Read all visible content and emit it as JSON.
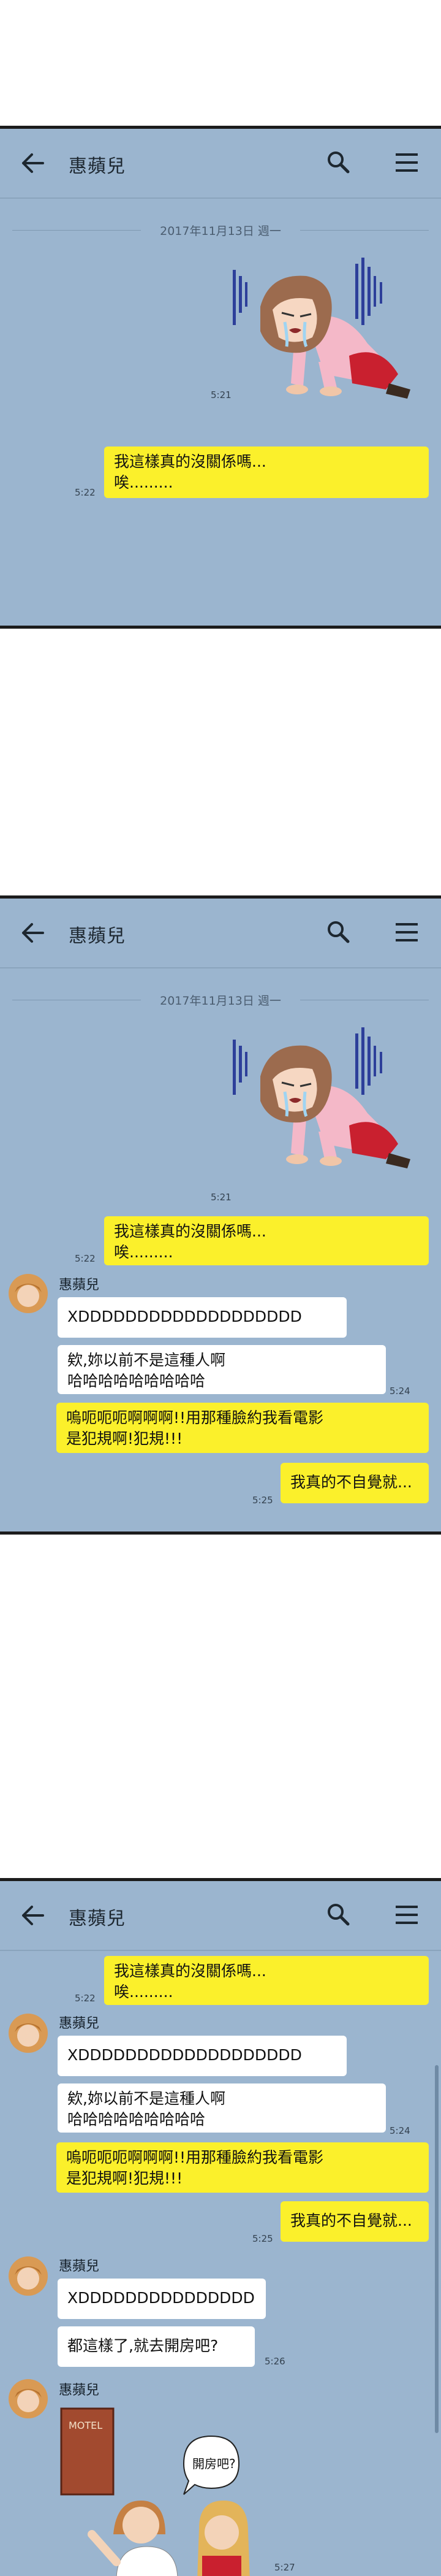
{
  "chat": {
    "title": "惠蘋兒"
  },
  "date_divider": "2017年11月13日 週一",
  "p1": {
    "sticker_time": "5:21",
    "msg1": {
      "text": "我這樣真的沒關係嗎...\n唉.........",
      "time": "5:22"
    }
  },
  "p2": {
    "sticker_time": "5:21",
    "msg1": {
      "text": "我這樣真的沒關係嗎...\n唉.........",
      "time": "5:22"
    },
    "sender": "惠蘋兒",
    "msg2": "XDDDDDDDDDDDDDDDDDDD",
    "msg3": "欸,妳以前不是這種人啊\n哈哈哈哈哈哈哈哈哈",
    "time2": "5:24",
    "msg4": "嗚呃呃呃啊啊啊!!用那種臉約我看電影\n是犯規啊!犯規!!!",
    "msg5": "我真的不自覺就...",
    "time3": "5:25"
  },
  "p3": {
    "msg1": {
      "text": "我這樣真的沒關係嗎...\n唉.........",
      "time": "5:22"
    },
    "sender": "惠蘋兒",
    "msg2": "XDDDDDDDDDDDDDDDDDDD",
    "msg3": "欸,妳以前不是這種人啊\n哈哈哈哈哈哈哈哈哈",
    "time2": "5:24",
    "msg4": "嗚呃呃呃啊啊啊!!用那種臉約我看電影\n是犯規啊!犯規!!!",
    "msg5": "我真的不自覺就...",
    "time3": "5:25",
    "sender2": "惠蘋兒",
    "msg6": "XDDDDDDDDDDDDDDD",
    "msg7": "都這樣了,就去開房吧?",
    "time4": "5:26",
    "sender3": "惠蘋兒",
    "sign_text": "MOTEL",
    "speech_text": "開房吧?",
    "time5": "5:27"
  },
  "colors": {
    "chat_bg": "#9bb5cf",
    "my_bubble": "#fbf02b",
    "their_bubble": "#ffffff"
  }
}
